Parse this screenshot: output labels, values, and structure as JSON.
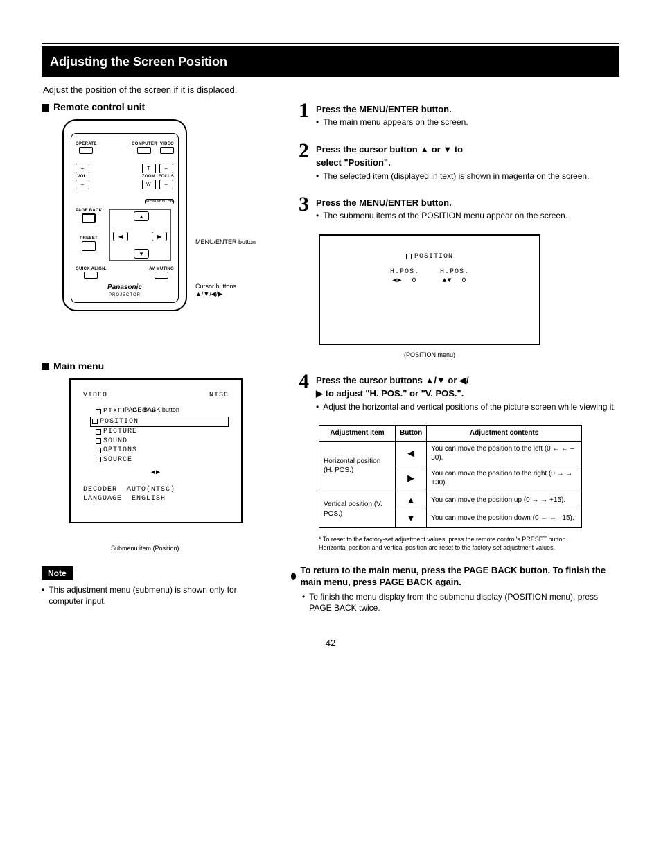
{
  "title_bar": "Adjusting the Screen Position",
  "page_number": "42",
  "intro": "Adjust the position of the screen if it is displaced.",
  "left": {
    "remote_heading": "Remote control unit",
    "remote": {
      "operate": "OPERATE",
      "computer": "COMPUTER",
      "video": "VIDEO",
      "vol": "VOL.",
      "zoom": "ZOOM",
      "focus": "FOCUS",
      "t": "T",
      "w": "W",
      "plus": "+",
      "minus": "−",
      "page_back": "PAGE BACK",
      "menu_enter": "MENU/ENTER",
      "preset": "PRESET",
      "quick_align": "QUICK ALIGN.",
      "av_muting": "AV MUTING",
      "brand": "Panasonic",
      "brand_sub": "PROJECTOR"
    },
    "callouts": {
      "menu_enter": "MENU/ENTER button",
      "cursor": "Cursor buttons\n▲/▼/◀/▶",
      "page_back": "PAGE BACK button"
    },
    "mainmenu_heading": "Main menu",
    "mainmenu": {
      "top_left": "VIDEO",
      "top_right": "NTSC",
      "items": [
        "PIXEL CLOCK",
        "POSITION",
        "PICTURE",
        "SOUND",
        "OPTIONS",
        "SOURCE"
      ],
      "decoder_label": "DECODER",
      "decoder_value": "AUTO(NTSC)",
      "language_label": "LANGUAGE",
      "language_value": "ENGLISH",
      "submenu_marker": "◀▶"
    },
    "mainmenu_caption": "Submenu item (Position)",
    "note_tag": "Note",
    "note_text": "This adjustment menu (submenu) is shown only for computer input."
  },
  "steps": {
    "s1": {
      "title": "Press the MENU/ENTER button.",
      "bullet": "The main menu appears on the screen."
    },
    "s2": {
      "title_a": "Press the cursor button ▲ or ▼ to",
      "title_b": "select \"Position\".",
      "bullet": "The selected item (displayed in text) is shown in magenta  on the screen."
    },
    "s3": {
      "title": "Press the MENU/ENTER button.",
      "bullet": "The submenu items of the POSITION menu appear on the screen."
    },
    "s4": {
      "title_a": "Press the cursor buttons ▲/▼ or ◀/",
      "title_b": "▶ to adjust \"H. POS.\" or \"V. POS.\".",
      "bullet": "Adjust the horizontal and vertical positions of the picture screen while viewing it."
    }
  },
  "submenu": {
    "header": "POSITION",
    "hpos_label": "H.POS.",
    "hpos_marker": "◀▶",
    "hpos_val": "0",
    "vpos_label": "H.POS.",
    "vpos_marker": "▲▼",
    "vpos_val": "0",
    "caption": "(POSITION menu)"
  },
  "memo": "* To reset to the factory-set adjustment values, press the remote control's PRESET button.  Horizontal position and vertical position are reset to the factory-set adjustment values.",
  "adj_table": {
    "headers": [
      "Adjustment item",
      "Button",
      "Adjustment contents"
    ],
    "rows": [
      {
        "name": "Horizontal position (H. POS.)",
        "sym": "◀",
        "desc": "You can move the position to the left (0 ← ← –30)."
      },
      {
        "name": "",
        "sym": "▶",
        "desc": "You can move the position to the right (0 → → +30)."
      },
      {
        "name": "Vertical position (V. POS.)",
        "sym": "▲",
        "desc": "You can move the position up (0 → → +15)."
      },
      {
        "name": "",
        "sym": "▼",
        "desc": "You can move the position down (0 ← ← –15)."
      }
    ]
  },
  "right_note": {
    "heading": "To return to the main menu, press the PAGE BACK button. To finish the main menu, press PAGE BACK again.",
    "bullet": "To finish the menu display from the submenu display (POSITION menu), press PAGE BACK twice."
  }
}
